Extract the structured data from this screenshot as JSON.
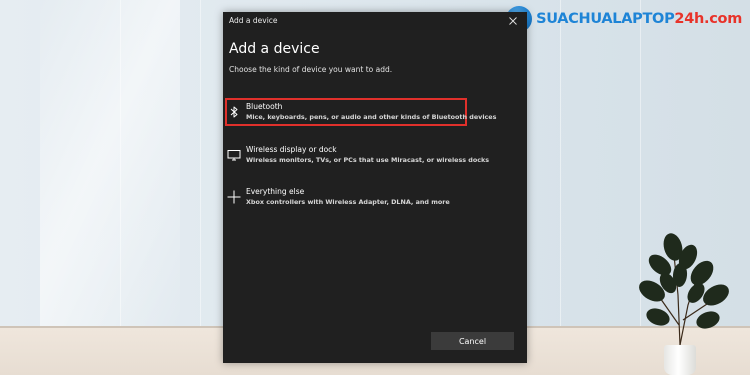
{
  "dialog": {
    "window_title": "Add a device",
    "heading": "Add a device",
    "subtitle": "Choose the kind of device you want to add.",
    "options": [
      {
        "icon": "bluetooth-icon",
        "title": "Bluetooth",
        "description": "Mice, keyboards, pens, or audio and other kinds of Bluetooth devices",
        "highlighted": true
      },
      {
        "icon": "monitor-icon",
        "title": "Wireless display or dock",
        "description": "Wireless monitors, TVs, or PCs that use Miracast, or wireless docks",
        "highlighted": false
      },
      {
        "icon": "plus-icon",
        "title": "Everything else",
        "description": "Xbox controllers with Wireless Adapter, DLNA, and more",
        "highlighted": false
      }
    ],
    "cancel_label": "Cancel"
  },
  "logo": {
    "text_part1": "SUACHUALAPTOP",
    "text_part2": "24h.com",
    "colors": {
      "primary": "#1e84d6",
      "secondary": "#e8332a"
    }
  },
  "colors": {
    "dialog_bg": "#202020",
    "highlight_border": "#e0302b",
    "button_bg": "#3b3b3b"
  }
}
